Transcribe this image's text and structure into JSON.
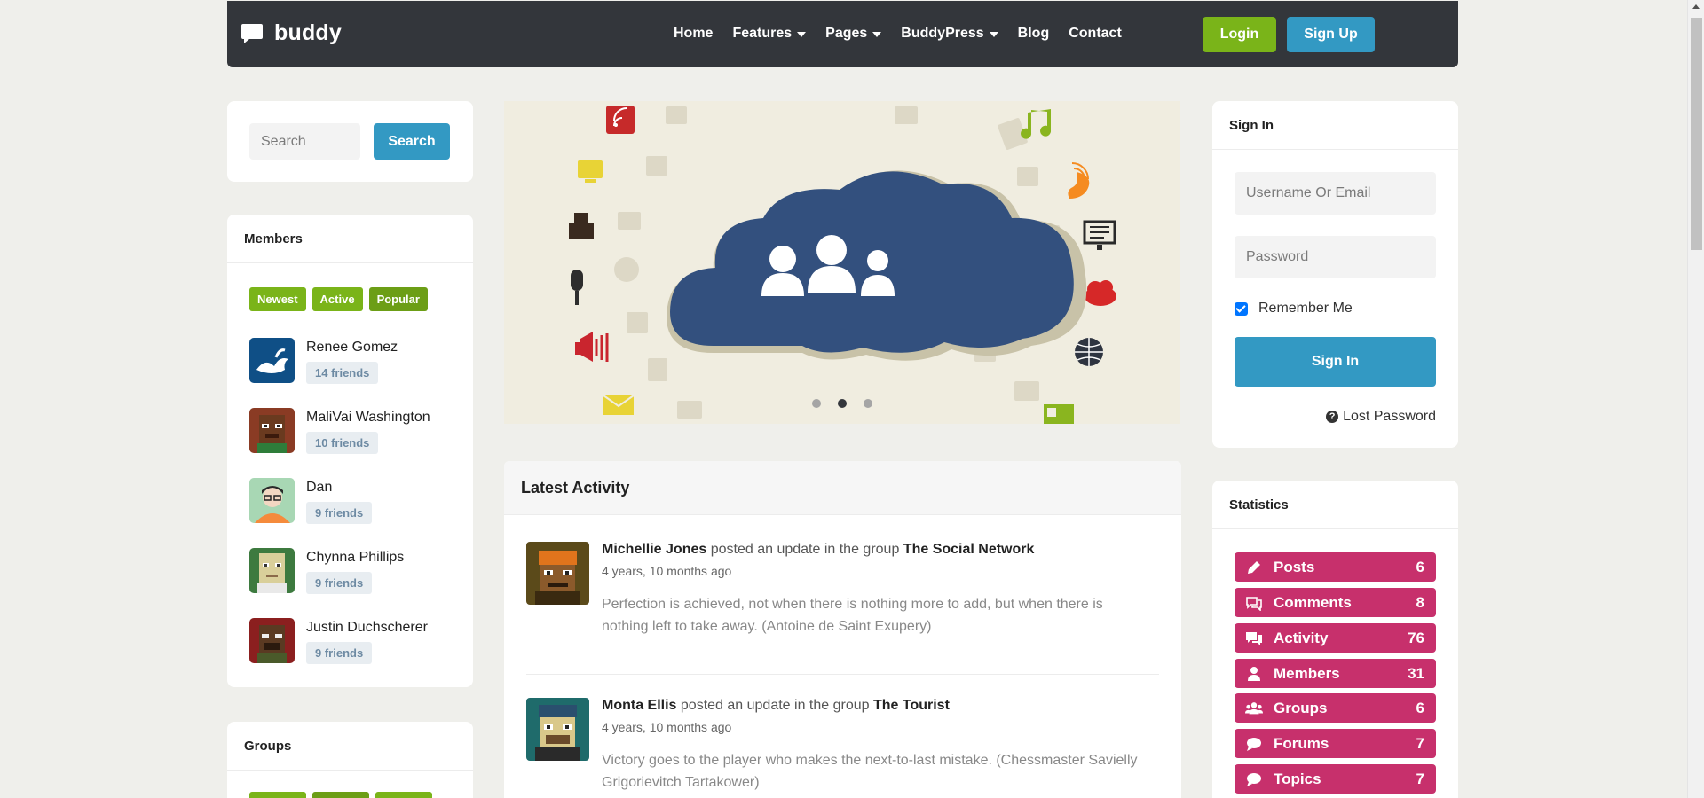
{
  "header": {
    "logo_text": "buddy",
    "nav": [
      "Home",
      "Features",
      "Pages",
      "BuddyPress",
      "Blog",
      "Contact"
    ],
    "login": "Login",
    "signup": "Sign Up"
  },
  "search": {
    "placeholder": "Search",
    "button": "Search"
  },
  "members": {
    "title": "Members",
    "tabs": [
      "Newest",
      "Active",
      "Popular"
    ],
    "list": [
      {
        "name": "Renee Gomez",
        "friends": "14 friends"
      },
      {
        "name": "MaliVai Washington",
        "friends": "10 friends"
      },
      {
        "name": "Dan",
        "friends": "9 friends"
      },
      {
        "name": "Chynna Phillips",
        "friends": "9 friends"
      },
      {
        "name": "Justin Duchscherer",
        "friends": "9 friends"
      }
    ]
  },
  "groups": {
    "title": "Groups"
  },
  "slider": {
    "slides": 3,
    "active_slide": 2
  },
  "activity": {
    "title": "Latest Activity",
    "items": [
      {
        "user": "Michellie Jones",
        "action": "posted an update in the group",
        "group": "The Social Network",
        "time": "4 years, 10 months ago",
        "text": "Perfection is achieved, not when there is nothing more to add, but when there is nothing left to take away. (Antoine de Saint Exupery)"
      },
      {
        "user": "Monta Ellis",
        "action": "posted an update in the group",
        "group": "The Tourist",
        "time": "4 years, 10 months ago",
        "text": "Victory goes to the player who makes the next-to-last mistake. (Chessmaster Savielly Grigorievitch Tartakower)"
      }
    ]
  },
  "signin": {
    "title": "Sign In",
    "username_placeholder": "Username Or Email",
    "password_placeholder": "Password",
    "remember": "Remember Me",
    "button": "Sign In",
    "lost": "Lost Password"
  },
  "statistics": {
    "title": "Statistics",
    "items": [
      {
        "label": "Posts",
        "count": "6",
        "icon": "pencil-icon"
      },
      {
        "label": "Comments",
        "count": "8",
        "icon": "comments-icon"
      },
      {
        "label": "Activity",
        "count": "76",
        "icon": "activity-icon"
      },
      {
        "label": "Members",
        "count": "31",
        "icon": "user-icon"
      },
      {
        "label": "Groups",
        "count": "6",
        "icon": "users-icon"
      },
      {
        "label": "Forums",
        "count": "7",
        "icon": "comment-icon"
      },
      {
        "label": "Topics",
        "count": "7",
        "icon": "comment-icon"
      }
    ]
  },
  "colors": {
    "header_bg": "#33363b",
    "green": "#7ab419",
    "blue": "#3399c3",
    "stat_pink": "#c7306c",
    "cloud": "#33507e"
  }
}
